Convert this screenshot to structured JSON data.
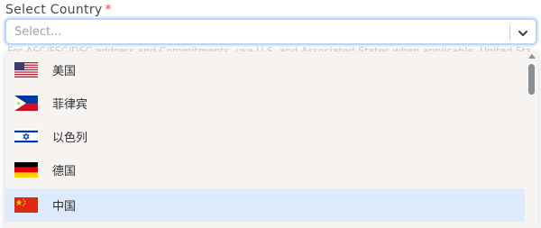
{
  "field": {
    "label": "Select Country",
    "required_mark": "*",
    "placeholder": "Select...",
    "helper_text": "For ASC/FSC/DSC address and Commitments, use U.S. and Associated States when applicable, United States"
  },
  "dropdown": {
    "options": [
      {
        "label": "美国",
        "flag": "flag-us-icon",
        "selected": false
      },
      {
        "label": "菲律宾",
        "flag": "flag-ph-icon",
        "selected": false
      },
      {
        "label": "以色列",
        "flag": "flag-il-icon",
        "selected": false
      },
      {
        "label": "德国",
        "flag": "flag-de-icon",
        "selected": false
      },
      {
        "label": "中国",
        "flag": "flag-cn-icon",
        "selected": true
      }
    ]
  },
  "colors": {
    "focus_border": "#b8d6f6",
    "menu_bg": "#f7f3f1",
    "selected_bg": "#deebfc",
    "required": "#e5484d"
  }
}
